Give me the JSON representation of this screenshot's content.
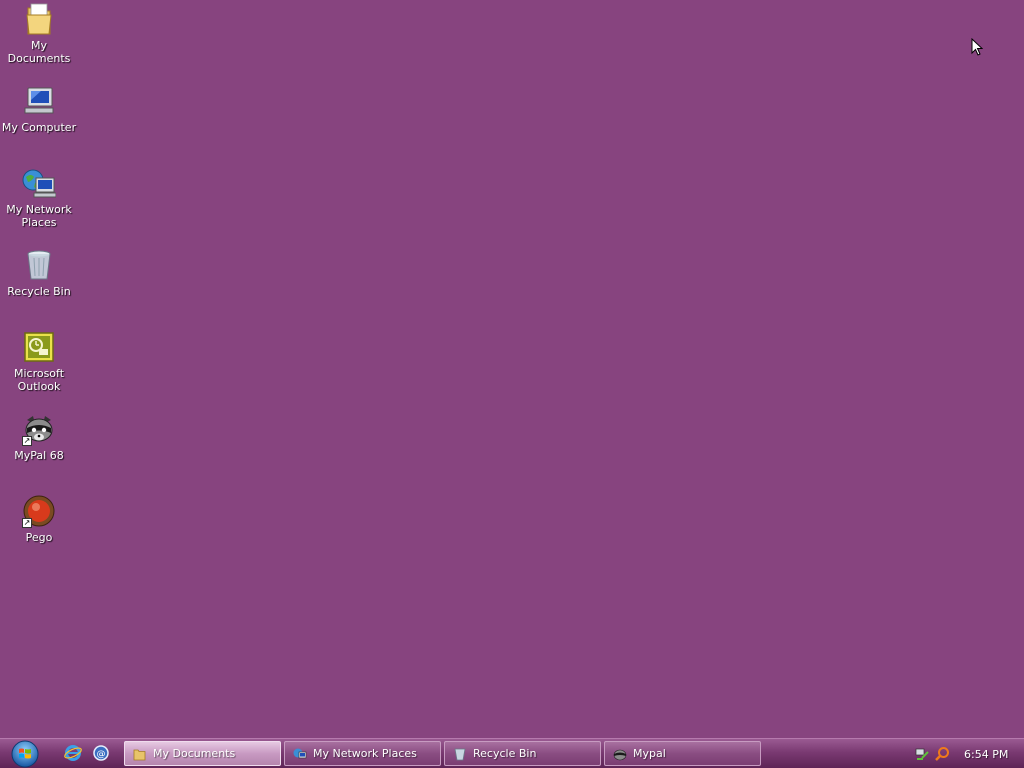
{
  "desktop": {
    "background_color": "#87447f",
    "icons": [
      {
        "label": "My Documents",
        "icon": "folder-icon"
      },
      {
        "label": "My Computer",
        "icon": "computer-icon"
      },
      {
        "label": "My Network Places",
        "icon": "network-places-icon"
      },
      {
        "label": "Recycle Bin",
        "icon": "recycle-bin-icon"
      },
      {
        "label": "Microsoft Outlook",
        "icon": "outlook-icon"
      },
      {
        "label": "MyPal 68",
        "icon": "mypal-raccoon-icon"
      },
      {
        "label": "Pego",
        "icon": "pego-icon"
      }
    ]
  },
  "taskbar": {
    "start_icon": "windows-start-orb-icon",
    "quick_launch": [
      {
        "icon": "internet-explorer-icon"
      },
      {
        "icon": "show-desktop-icon"
      }
    ],
    "tasks": [
      {
        "label": "My Documents",
        "icon": "folder-icon",
        "active": true
      },
      {
        "label": "My Network Places",
        "icon": "network-places-icon",
        "active": false
      },
      {
        "label": "Recycle Bin",
        "icon": "recycle-bin-icon",
        "active": false
      },
      {
        "label": "Mypal",
        "icon": "mypal-raccoon-icon",
        "active": false
      }
    ],
    "tray_icons": [
      {
        "icon": "network-tray-icon"
      },
      {
        "icon": "search-tray-icon"
      }
    ],
    "clock": "6:54 PM"
  }
}
